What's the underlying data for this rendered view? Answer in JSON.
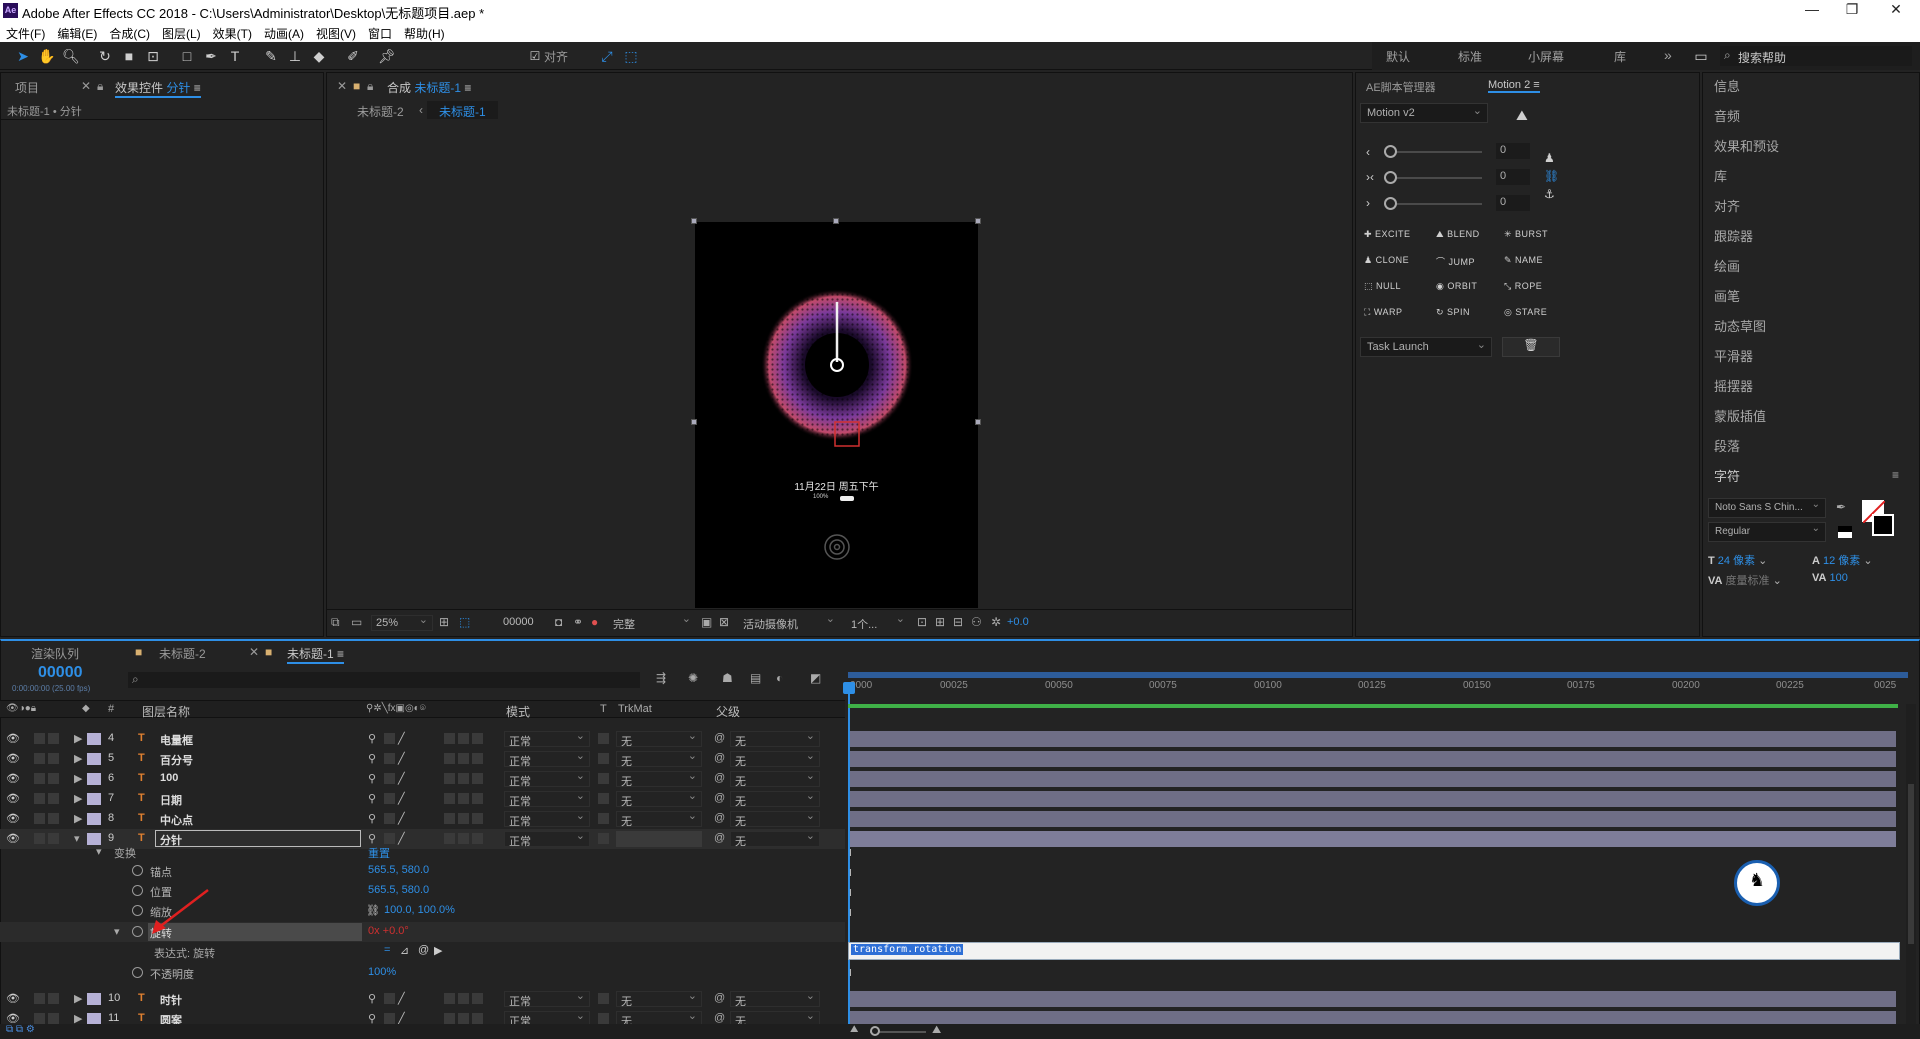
{
  "app": {
    "title": "Adobe After Effects CC 2018 - C:\\Users\\Administrator\\Desktop\\无标题项目.aep *",
    "logo": "Ae"
  },
  "window_controls": {
    "minimize": "—",
    "maximize": "❐",
    "close": "✕"
  },
  "menu": [
    "文件(F)",
    "编辑(E)",
    "合成(C)",
    "图层(L)",
    "效果(T)",
    "动画(A)",
    "视图(V)",
    "窗口",
    "帮助(H)"
  ],
  "toolbar": {
    "snap_label": "对齐"
  },
  "workspaces": [
    "默认",
    "标准",
    "小屏幕",
    "库"
  ],
  "workspace_more": "»",
  "search_help_placeholder": "搜索帮助",
  "project_panel": {
    "tab_project": "项目",
    "tab_effects": "效果控件",
    "tab_effects_target": "分针",
    "breadcrumb": "未标题-1 • 分针"
  },
  "comp_panel": {
    "tab_prefix": "合成",
    "tab_name": "未标题-1",
    "crumb_prev": "未标题-2",
    "crumb_current": "未标题-1",
    "date_text": "11月22日 周五下午",
    "battery_text": "100%",
    "zoom": "25%",
    "timecode": "00000",
    "quality": "完整",
    "camera": "活动摄像机",
    "views": "1个...",
    "exposure": "+0.0"
  },
  "scripts_panel": {
    "tab_scripts": "AE脚本管理器",
    "tab_motion": "Motion 2",
    "preset": "Motion v2",
    "values": [
      "0",
      "0",
      "0"
    ],
    "buttons": [
      "EXCITE",
      "BLEND",
      "BURST",
      "CLONE",
      "JUMP",
      "NAME",
      "NULL",
      "ORBIT",
      "ROPE",
      "WARP",
      "SPIN",
      "STARE"
    ],
    "task": "Task Launch"
  },
  "right_list": [
    "信息",
    "音频",
    "效果和预设",
    "库",
    "对齐",
    "跟踪器",
    "绘画",
    "画笔",
    "动态草图",
    "平滑器",
    "摇摆器",
    "蒙版插值",
    "段落",
    "字符"
  ],
  "character": {
    "font": "Noto Sans S Chin...",
    "style": "Regular",
    "size": "24 像素",
    "leading": "12 像素",
    "tracking": "度量标准",
    "kerning": "100"
  },
  "timeline": {
    "tab_render": "渲染队列",
    "tab_comp2": "未标题-2",
    "tab_comp1": "未标题-1",
    "timecode": "00000",
    "fps": "0:00:00:00 (25.00 fps)",
    "col_layer": "图层名称",
    "col_num": "#",
    "col_mode": "模式",
    "col_t": "T",
    "col_trkmat": "TrkMat",
    "col_parent": "父级",
    "ruler": [
      "0000",
      "00025",
      "00050",
      "00075",
      "00100",
      "00125",
      "00150",
      "00175",
      "00200",
      "00225",
      "0025"
    ],
    "expression_text": "transform.rotation"
  },
  "layers": [
    {
      "num": "4",
      "name": "电量框",
      "mode": "正常",
      "trk": "无",
      "parent": "无"
    },
    {
      "num": "5",
      "name": "百分号",
      "mode": "正常",
      "trk": "无",
      "parent": "无"
    },
    {
      "num": "6",
      "name": "100",
      "mode": "正常",
      "trk": "无",
      "parent": "无"
    },
    {
      "num": "7",
      "name": "日期",
      "mode": "正常",
      "trk": "无",
      "parent": "无"
    },
    {
      "num": "8",
      "name": "中心点",
      "mode": "正常",
      "trk": "无",
      "parent": "无"
    },
    {
      "num": "9",
      "name": "分针",
      "mode": "正常",
      "trk": "",
      "parent": "无"
    },
    {
      "num": "10",
      "name": "时针",
      "mode": "正常",
      "trk": "无",
      "parent": "无"
    },
    {
      "num": "11",
      "name": "圆案",
      "mode": "正常",
      "trk": "无",
      "parent": "无"
    }
  ],
  "transform": {
    "label": "变换",
    "reset": "重置",
    "anchor": "锚点",
    "anchor_val": "565.5, 580.0",
    "position": "位置",
    "position_val": "565.5, 580.0",
    "scale": "缩放",
    "scale_val": "100.0, 100.0%",
    "rotation": "旋转",
    "rotation_val": "0x +0.0°",
    "expression_label": "表达式: 旋转",
    "opacity": "不透明度",
    "opacity_val": "100%"
  },
  "colors": {
    "accent": "#2e8fe6",
    "bar": "#6f6e86",
    "green": "#3fb047"
  }
}
